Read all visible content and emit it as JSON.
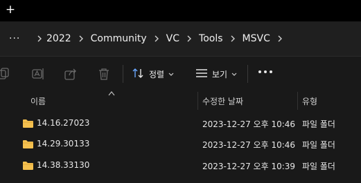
{
  "titlebar": {
    "new_tab": "+"
  },
  "breadcrumb": {
    "overflow": "···",
    "items": [
      "2022",
      "Community",
      "VC",
      "Tools",
      "MSVC"
    ]
  },
  "toolbar": {
    "sort_label": "정렬",
    "view_label": "보기"
  },
  "columns": {
    "name": "이름",
    "modified": "수정한 날짜",
    "type": "유형"
  },
  "rows": [
    {
      "name": "14.16.27023",
      "modified": "2023-12-27 오후 10:46",
      "type": "파일 폴더"
    },
    {
      "name": "14.29.30133",
      "modified": "2023-12-27 오후 10:46",
      "type": "파일 폴더"
    },
    {
      "name": "14.38.33130",
      "modified": "2023-12-27 오후 10:39",
      "type": "파일 폴더"
    }
  ],
  "colors": {
    "folder": "#f4c04f",
    "background": "#191919",
    "titlebar": "#000000"
  }
}
